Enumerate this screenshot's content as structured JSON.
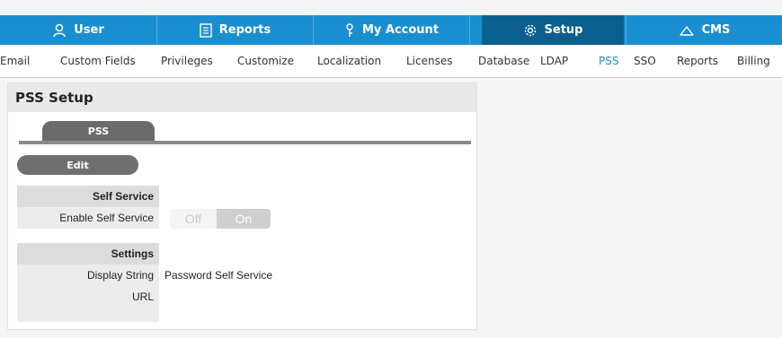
{
  "top_nav": {
    "tabs": [
      {
        "label": "User",
        "icon": "user-icon"
      },
      {
        "label": "Reports",
        "icon": "reports-icon"
      },
      {
        "label": "My Account",
        "icon": "key-icon"
      },
      {
        "label": "Setup",
        "icon": "gear-icon",
        "active": true
      },
      {
        "label": "CMS",
        "icon": "cloud-icon"
      }
    ],
    "colors": {
      "bar": "#1a8fd0",
      "active": "#0b5f8f"
    }
  },
  "sub_nav": {
    "items": [
      "Email",
      "Custom Fields",
      "Privileges",
      "Customize",
      "Localization",
      "Licenses",
      "Database",
      "LDAP",
      "PSS",
      "SSO",
      "Reports",
      "Billing"
    ],
    "active": "PSS"
  },
  "panel": {
    "title": "PSS Setup",
    "tab_label": "PSS",
    "edit_label": "Edit",
    "self_service_section": "Self Service",
    "enable_self_service_label": "Enable Self Service",
    "toggle": {
      "off_label": "Off",
      "on_label": "On",
      "value": "On"
    },
    "settings_section": "Settings",
    "display_string_label": "Display String",
    "display_string_value": "Password Self Service",
    "url_label": "URL",
    "url_value": ""
  }
}
